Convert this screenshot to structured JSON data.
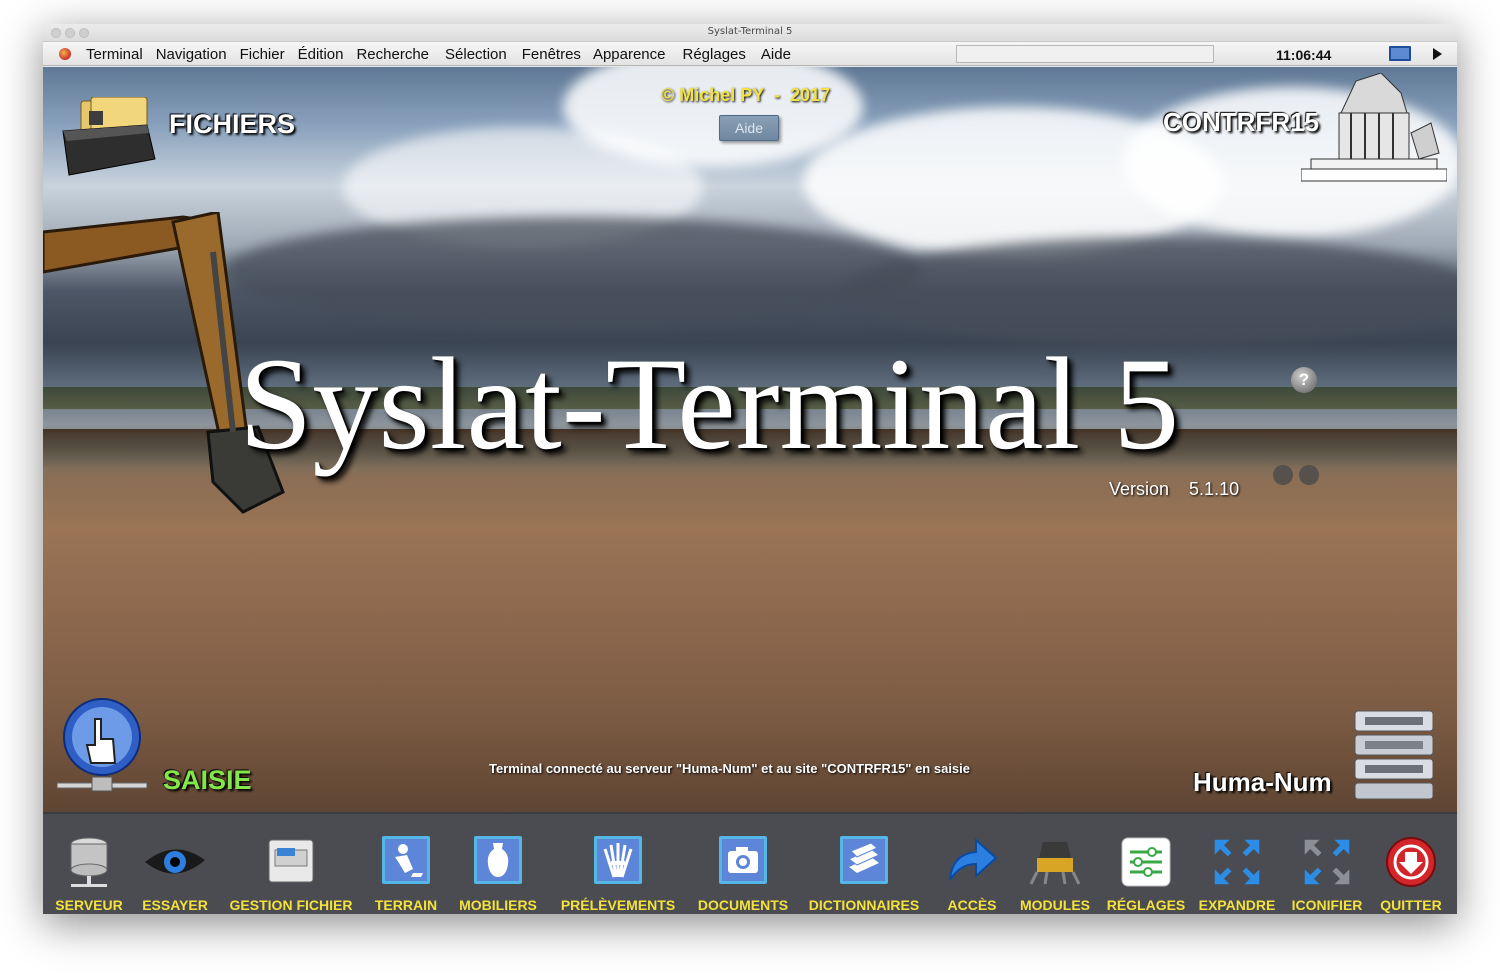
{
  "window": {
    "title": "Syslat-Terminal 5"
  },
  "menubar": {
    "items": [
      "Terminal",
      "Navigation",
      "Fichier",
      "Édition",
      "Recherche",
      "Sélection",
      "Fenêtres",
      "Apparence",
      "Réglages",
      "Aide"
    ],
    "clock": "11:06:44",
    "search_value": ""
  },
  "header": {
    "fichiers_label": "FICHIERS",
    "copyright": "© Michel PY  -  2017",
    "aide_button": "Aide",
    "site_label": "CONTRFR15"
  },
  "hero": {
    "title": "Syslat-Terminal 5",
    "help_glyph": "?",
    "version": "Version    5.1.10"
  },
  "footer_status": {
    "mode_label": "SAISIE",
    "status_text": "Terminal connecté au serveur \"Huma-Num\" et au site \"CONTRFR15\" en saisie",
    "server_label": "Huma-Num"
  },
  "toolbar": {
    "items": [
      {
        "label": "SERVEUR",
        "icon": "database-server-icon"
      },
      {
        "label": "ESSAYER",
        "icon": "eye-icon"
      },
      {
        "label": "GESTION FICHIER",
        "icon": "file-cabinet-icon"
      },
      {
        "label": "TERRAIN",
        "icon": "digging-worker-icon"
      },
      {
        "label": "MOBILIERS",
        "icon": "amphora-icon"
      },
      {
        "label": "PRÉLÈVEMENTS",
        "icon": "wheat-sheaf-icon"
      },
      {
        "label": "DOCUMENTS",
        "icon": "camera-icon"
      },
      {
        "label": "DICTIONNAIRES",
        "icon": "books-icon"
      },
      {
        "label": "ACCÈS",
        "icon": "arrow-right-icon"
      },
      {
        "label": "MODULES",
        "icon": "lunar-module-icon"
      },
      {
        "label": "RÉGLAGES",
        "icon": "sliders-icon"
      },
      {
        "label": "EXPANDRE",
        "icon": "expand-icon"
      },
      {
        "label": "ICONIFIER",
        "icon": "iconify-icon"
      },
      {
        "label": "QUITTER",
        "icon": "quit-icon"
      }
    ]
  },
  "colors": {
    "toolbar_bg": "#4a4c52",
    "toolbar_label": "#f4e23a",
    "copyright": "#f2e342",
    "mode_label": "#83e64b",
    "tile_blue": "#5d86d8"
  }
}
